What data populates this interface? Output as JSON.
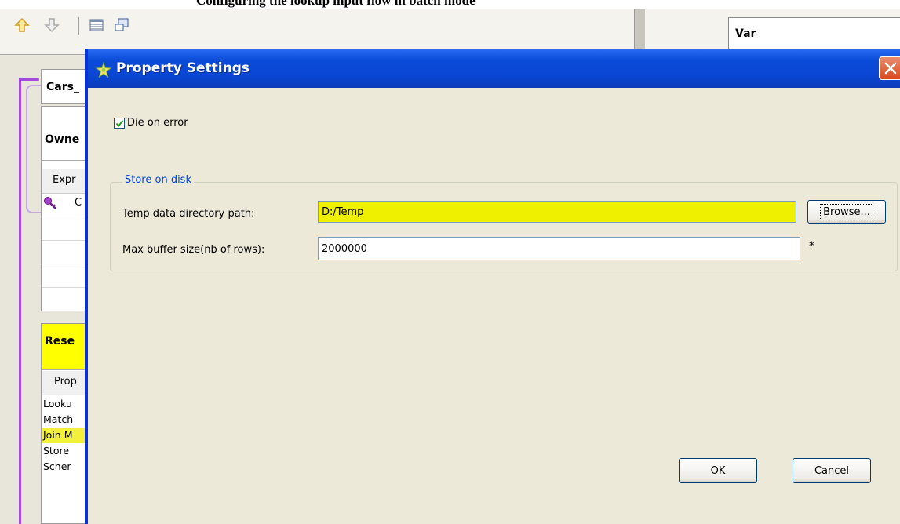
{
  "header": {
    "cropped_title": "Configuring the lookup input flow in batch mode"
  },
  "toolbar": {
    "icons": [
      "up-arrow-icon",
      "down-arrow-icon",
      "table-icon",
      "window-icon"
    ]
  },
  "background": {
    "var_panel_title": "Var",
    "cars_panel_title": "Cars_",
    "owner_panel_title": "Owne",
    "owner_column_header": "Expr",
    "owner_row_text": "C",
    "reset_panel_title": "Rese",
    "reset_column_header": "Prop",
    "reset_rows": [
      "Looku",
      "Match",
      "Join M",
      "Store",
      "Scher"
    ]
  },
  "dialog": {
    "title": "Property Settings",
    "die_on_error": {
      "label": "Die on error",
      "checked": true
    },
    "store_group": {
      "legend": "Store on disk",
      "temp_dir_label": "Temp data directory path:",
      "temp_dir_value": "D:/Temp",
      "browse_label": "Browse...",
      "buffer_label": "Max buffer size(nb of rows):",
      "buffer_value": "2000000",
      "required_mark": "*"
    },
    "ok_label": "OK",
    "cancel_label": "Cancel"
  },
  "colors": {
    "titlebar": "#0A46D3",
    "highlight": "#EFEF00",
    "legend_text": "#0046D5",
    "connector": "#A54BDB"
  }
}
